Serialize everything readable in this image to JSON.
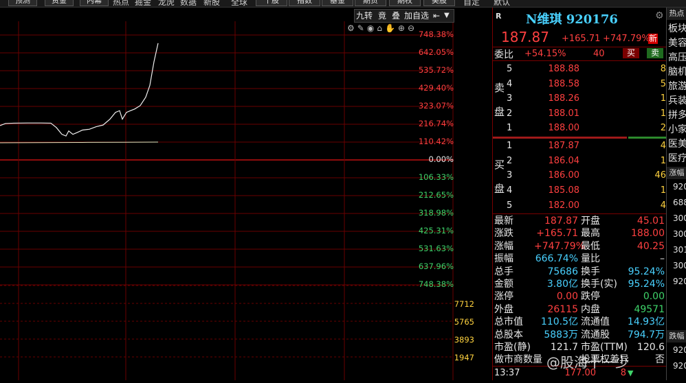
{
  "toolbar": {
    "buttons": [
      "预测",
      "资金",
      "内幕",
      "热点",
      "掘金",
      "龙虎",
      "数据",
      "新股",
      "全球",
      "十股",
      "指数",
      "基金",
      "期货",
      "期权",
      "美股"
    ],
    "extras": [
      "自定",
      "默认"
    ]
  },
  "chart_tools": {
    "jiuzhuan": "九转",
    "jing": "竟",
    "die": "叠",
    "add_watch": "加自选"
  },
  "chart_data": {
    "type": "line",
    "axis_right_upper": [
      "748.38%",
      "642.05%",
      "535.72%",
      "429.40%",
      "323.07%",
      "216.74%",
      "110.42%",
      "0.00%",
      "106.33%",
      "212.65%",
      "318.98%",
      "425.31%",
      "531.63%",
      "637.96%",
      "748.38%"
    ],
    "volume_axis": [
      "7712",
      "5765",
      "3893",
      "1947"
    ],
    "price_series": [
      {
        "t": 0,
        "v": 212
      },
      {
        "t": 8,
        "v": 224
      },
      {
        "t": 20,
        "v": 226
      },
      {
        "t": 40,
        "v": 227
      },
      {
        "t": 60,
        "v": 227
      },
      {
        "t": 74,
        "v": 226
      },
      {
        "t": 82,
        "v": 200
      },
      {
        "t": 90,
        "v": 160
      },
      {
        "t": 96,
        "v": 150
      },
      {
        "t": 100,
        "v": 180
      },
      {
        "t": 106,
        "v": 160
      },
      {
        "t": 112,
        "v": 170
      },
      {
        "t": 120,
        "v": 185
      },
      {
        "t": 130,
        "v": 190
      },
      {
        "t": 140,
        "v": 205
      },
      {
        "t": 150,
        "v": 215
      },
      {
        "t": 160,
        "v": 250
      },
      {
        "t": 168,
        "v": 290
      },
      {
        "t": 174,
        "v": 300
      },
      {
        "t": 178,
        "v": 250
      },
      {
        "t": 184,
        "v": 290
      },
      {
        "t": 190,
        "v": 300
      },
      {
        "t": 196,
        "v": 310
      },
      {
        "t": 204,
        "v": 330
      },
      {
        "t": 212,
        "v": 380
      },
      {
        "t": 218,
        "v": 450
      },
      {
        "t": 224,
        "v": 590
      },
      {
        "t": 230,
        "v": 700
      }
    ],
    "avg_series": [
      {
        "t": 0,
        "v": 110
      },
      {
        "t": 60,
        "v": 111
      },
      {
        "t": 120,
        "v": 112
      },
      {
        "t": 180,
        "v": 113
      },
      {
        "t": 230,
        "v": 114
      }
    ]
  },
  "quote": {
    "tag": "R",
    "name": "N维琪 920176",
    "price": "187.87",
    "change": "+165.71",
    "change_pct": "+747.79%",
    "new_badge": "新",
    "weibi_label": "委比",
    "weibi": "+54.15%",
    "weicha": "40",
    "buy_btn": "买",
    "sell_btn": "卖",
    "sell_side_label": [
      "卖",
      "盘"
    ],
    "buy_side_label": [
      "买",
      "盘"
    ],
    "asks": [
      {
        "level": "5",
        "price": "188.88",
        "vol": "8"
      },
      {
        "level": "4",
        "price": "188.58",
        "vol": "5"
      },
      {
        "level": "3",
        "price": "188.26",
        "vol": "1"
      },
      {
        "level": "2",
        "price": "188.01",
        "vol": "1"
      },
      {
        "level": "1",
        "price": "188.00",
        "vol": "2"
      }
    ],
    "bids": [
      {
        "level": "1",
        "price": "187.87",
        "vol": "4"
      },
      {
        "level": "2",
        "price": "186.04",
        "vol": "1"
      },
      {
        "level": "3",
        "price": "186.00",
        "vol": "46"
      },
      {
        "level": "4",
        "price": "185.08",
        "vol": "1"
      },
      {
        "level": "5",
        "price": "182.00",
        "vol": "4"
      }
    ],
    "stats": [
      {
        "k1": "最新",
        "v1": "187.87",
        "c1": "up",
        "k2": "开盘",
        "v2": "45.01",
        "c2": "up"
      },
      {
        "k1": "涨跌",
        "v1": "+165.71",
        "c1": "up",
        "k2": "最高",
        "v2": "188.00",
        "c2": "up"
      },
      {
        "k1": "涨幅",
        "v1": "+747.79%",
        "c1": "up",
        "k2": "最低",
        "v2": "40.25",
        "c2": "up"
      },
      {
        "k1": "振幅",
        "v1": "666.74%",
        "c1": "cy",
        "k2": "量比",
        "v2": "–",
        "c2": "wh"
      },
      {
        "k1": "总手",
        "v1": "75686",
        "c1": "cy",
        "k2": "换手",
        "v2": "95.24%",
        "c2": "cy"
      },
      {
        "k1": "金额",
        "v1": "3.80亿",
        "c1": "cy",
        "k2": "换手(实)",
        "v2": "95.24%",
        "c2": "cy"
      },
      {
        "k1": "涨停",
        "v1": "0.00",
        "c1": "up",
        "k2": "跌停",
        "v2": "0.00",
        "c2": "dn"
      },
      {
        "k1": "外盘",
        "v1": "26115",
        "c1": "up",
        "k2": "内盘",
        "v2": "49571",
        "c2": "dn"
      },
      {
        "k1": "总市值",
        "v1": "110.5亿",
        "c1": "cy",
        "k2": "流通值",
        "v2": "14.93亿",
        "c2": "cy"
      },
      {
        "k1": "总股本",
        "v1": "5883万",
        "c1": "cy",
        "k2": "流通股",
        "v2": "794.7万",
        "c2": "cy"
      },
      {
        "k1": "市盈(静)",
        "v1": "121.7",
        "c1": "wh",
        "k2": "市盈(TTM)",
        "v2": "120.6",
        "c2": "wh"
      },
      {
        "k1": "做市商数量",
        "v1": "",
        "c1": "wh",
        "k2": "投票权差异",
        "v2": "否",
        "c2": "wh"
      }
    ],
    "last_trade": {
      "time": "13:37",
      "price": "177.00",
      "vol": "8"
    }
  },
  "sector": {
    "header": "热点",
    "items": [
      "板块",
      "美容",
      "高压",
      "脑机",
      "旅游",
      "兵装",
      "拼多",
      "小家",
      "医美",
      "医疗"
    ],
    "rise_header": "涨幅",
    "rise_nums": [
      "920",
      "688",
      "300",
      "300",
      "301",
      "300",
      "920"
    ],
    "fall_header": "跌幅",
    "fall_nums": [
      "920",
      "920"
    ]
  },
  "watermark": "@股海十一少"
}
